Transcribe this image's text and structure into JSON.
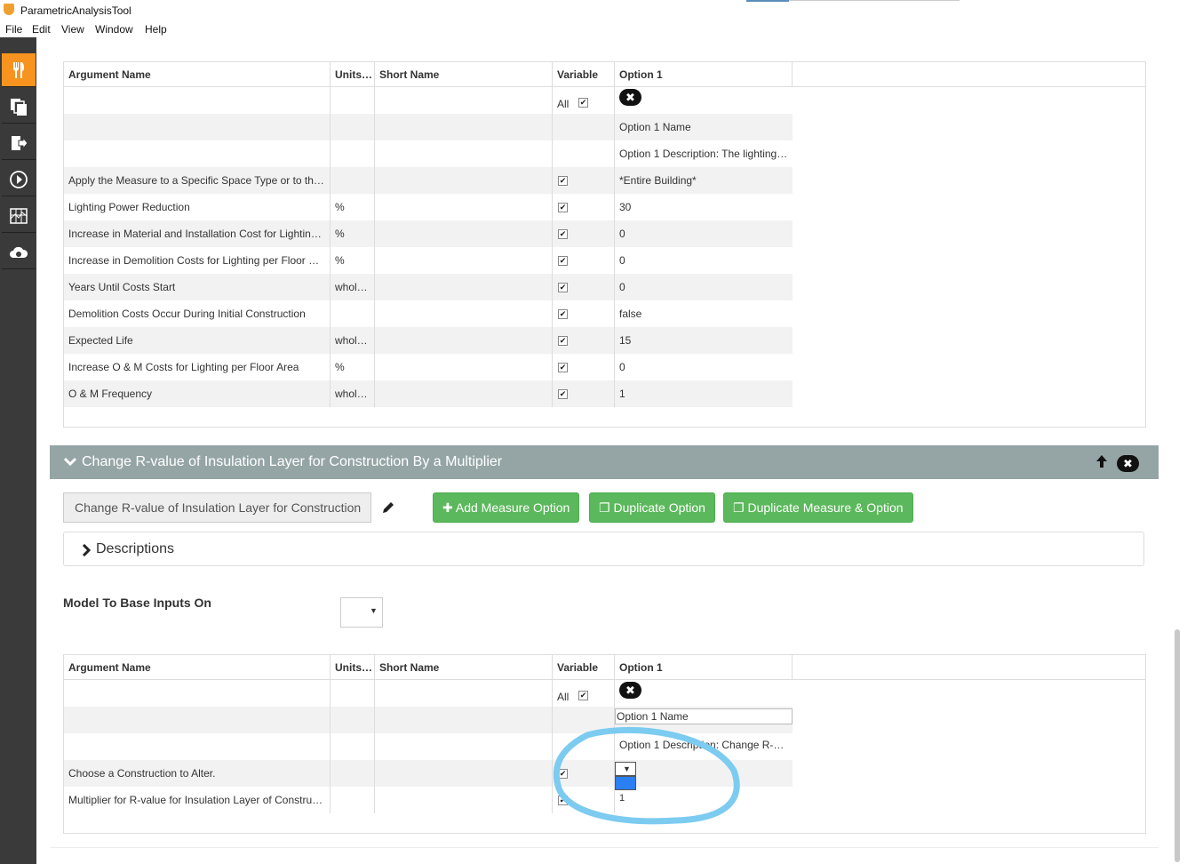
{
  "window": {
    "title": "ParametricAnalysisTool"
  },
  "menu": [
    "File",
    "Edit",
    "View",
    "Window",
    "Help"
  ],
  "sidebar": {
    "items": [
      "measures-icon",
      "design-alternatives-icon",
      "outputs-icon",
      "run-icon",
      "results-icon",
      "cloud-icon"
    ]
  },
  "table_headers": {
    "argument_name": "Argument Name",
    "units": "Units…",
    "short_name": "Short Name",
    "variable": "Variable",
    "option1": "Option 1"
  },
  "table1": {
    "all_label": "All",
    "option_name": "Option 1 Name",
    "option_description": "Option 1 Description: The lighting…",
    "rows": [
      {
        "name": "Apply the Measure to a Specific Space Type or to th…",
        "units": "",
        "value": "*Entire Building*"
      },
      {
        "name": "Lighting Power Reduction",
        "units": "%",
        "value": "30"
      },
      {
        "name": "Increase in Material and Installation Cost for Lightin…",
        "units": "%",
        "value": "0"
      },
      {
        "name": "Increase in Demolition Costs for Lighting per Floor …",
        "units": "%",
        "value": "0"
      },
      {
        "name": "Years Until Costs Start",
        "units": "whol…",
        "value": "0"
      },
      {
        "name": "Demolition Costs Occur During Initial Construction",
        "units": "",
        "value": "false"
      },
      {
        "name": "Expected Life",
        "units": "whol…",
        "value": "15"
      },
      {
        "name": "Increase O & M Costs for Lighting per Floor Area",
        "units": "%",
        "value": "0"
      },
      {
        "name": "O & M Frequency",
        "units": "whol…",
        "value": "1"
      }
    ]
  },
  "measure": {
    "title": "Change R-value of Insulation Layer for Construction By a Multiplier",
    "name_value": "Change R-value of Insulation Layer for Construction",
    "add_option_label": "Add Measure Option",
    "duplicate_option_label": "Duplicate Option",
    "duplicate_measure_label": "Duplicate Measure & Option",
    "descriptions_label": "Descriptions",
    "model_label": "Model To Base Inputs On"
  },
  "table2": {
    "all_label": "All",
    "option_name": "Option 1 Name",
    "option_description": "Option 1 Description: Change R-…",
    "rows": [
      {
        "name": "Choose a Construction to Alter.",
        "units": "",
        "value": ""
      },
      {
        "name": "Multiplier for R-value for Insulation Layer of Constru…",
        "units": "",
        "value": "1"
      }
    ]
  },
  "colors": {
    "accent": "#f7931e",
    "green": "#5cb85c",
    "header_gray": "#95a5a6",
    "annotation": "#7ccbf0",
    "selected": "#2a7ff2"
  }
}
